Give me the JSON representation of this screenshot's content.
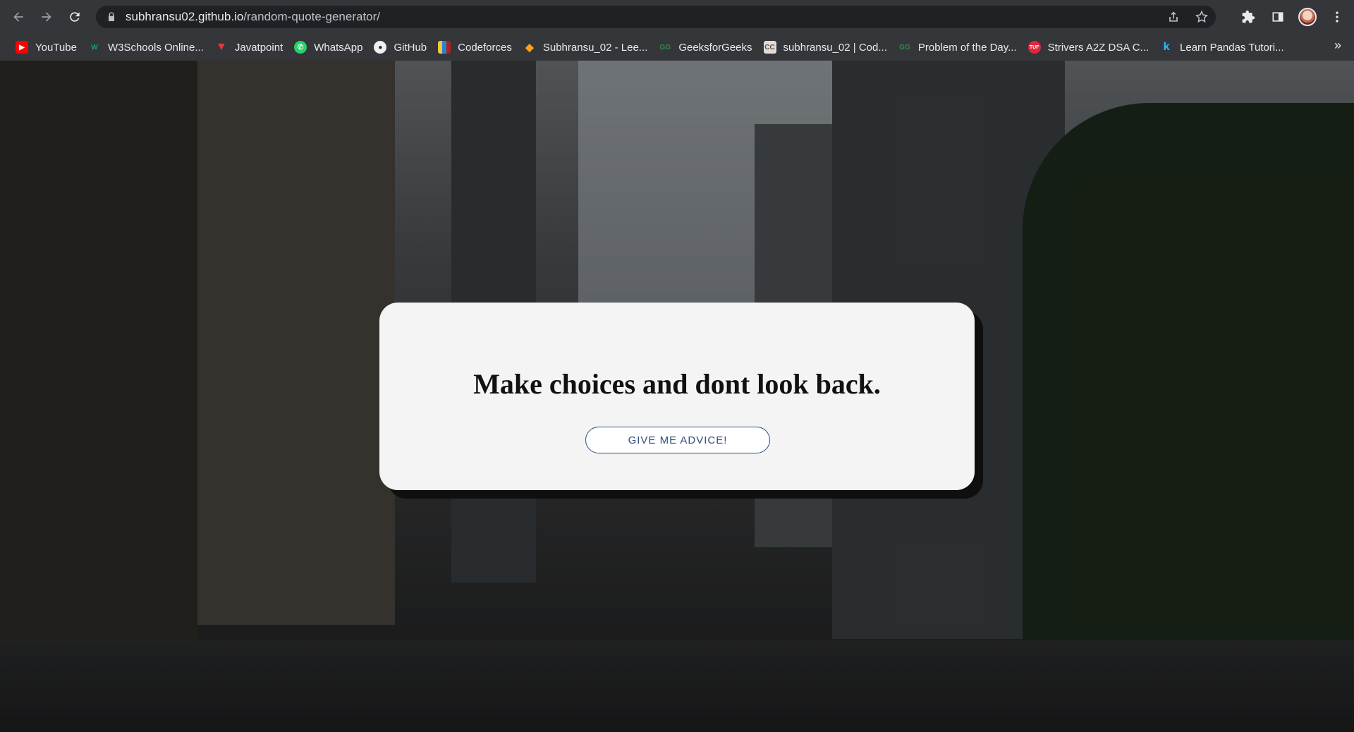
{
  "browser": {
    "url_host": "subhransu02.github.io",
    "url_path": "/random-quote-generator/",
    "bookmarks": [
      {
        "label": "YouTube",
        "color": "#ff0000"
      },
      {
        "label": "W3Schools Online...",
        "color": "#04aa6d"
      },
      {
        "label": "Javatpoint",
        "color": "#e53935"
      },
      {
        "label": "WhatsApp",
        "color": "#25d366"
      },
      {
        "label": "GitHub",
        "color": "#f0f0f0"
      },
      {
        "label": "Codeforces",
        "color": "#1f8acb"
      },
      {
        "label": "Subhransu_02 - Lee...",
        "color": "#ffa116"
      },
      {
        "label": "GeeksforGeeks",
        "color": "#2f8d46"
      },
      {
        "label": "subhransu_02 | Cod...",
        "color": "#6b4e2e"
      },
      {
        "label": "Problem of the Day...",
        "color": "#2f8d46"
      },
      {
        "label": "Strivers A2Z DSA C...",
        "color": "#e3263b"
      },
      {
        "label": "Learn Pandas Tutori...",
        "color": "#20beff"
      }
    ],
    "more_label": "»"
  },
  "quote_card": {
    "quote": "Make choices and dont look back.",
    "button_label": "GIVE ME ADVICE!"
  }
}
